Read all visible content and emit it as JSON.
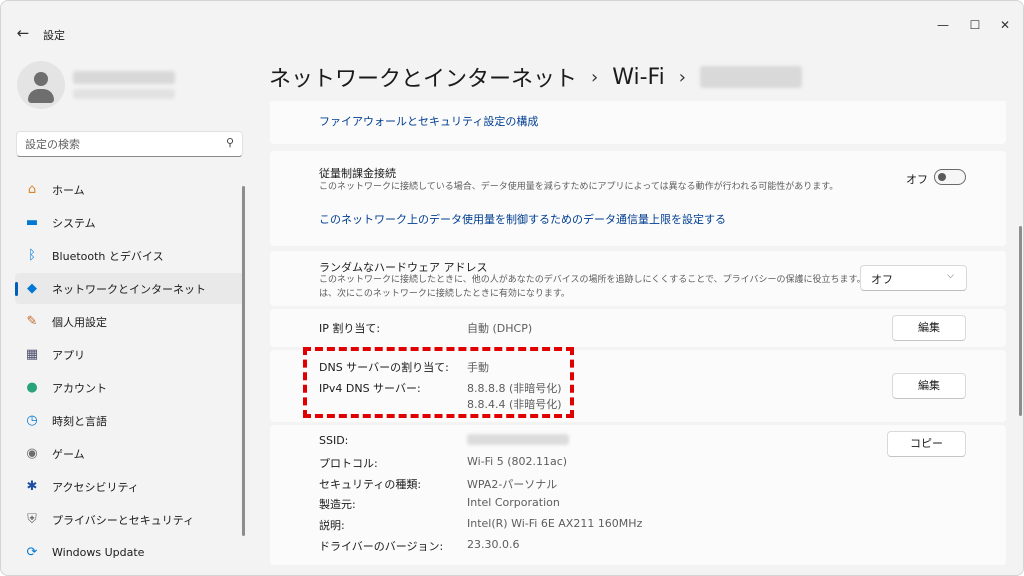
{
  "window": {
    "title": "設定",
    "back_icon": "←",
    "minimize_icon": "—",
    "maximize_icon": "☐",
    "close_icon": "✕"
  },
  "search": {
    "placeholder": "設定の検索",
    "icon": "⚲"
  },
  "sidebar": {
    "items": [
      {
        "label": "ホーム",
        "icon": "home-icon",
        "glyph": "⌂",
        "color": "#d9822b"
      },
      {
        "label": "システム",
        "icon": "system-icon",
        "glyph": "▬",
        "color": "#0078d4"
      },
      {
        "label": "Bluetooth とデバイス",
        "icon": "bluetooth-icon",
        "glyph": "ᛒ",
        "color": "#0078d4"
      },
      {
        "label": "ネットワークとインターネット",
        "icon": "wifi-icon",
        "glyph": "◆",
        "color": "#0078d4",
        "active": true
      },
      {
        "label": "個人用設定",
        "icon": "brush-icon",
        "glyph": "✎",
        "color": "#c0692a"
      },
      {
        "label": "アプリ",
        "icon": "apps-icon",
        "glyph": "▦",
        "color": "#4a4a6a"
      },
      {
        "label": "アカウント",
        "icon": "account-icon",
        "glyph": "●",
        "color": "#2aa37a"
      },
      {
        "label": "時刻と言語",
        "icon": "clock-globe-icon",
        "glyph": "◷",
        "color": "#0078d4"
      },
      {
        "label": "ゲーム",
        "icon": "gamepad-icon",
        "glyph": "◉",
        "color": "#6e6e6e"
      },
      {
        "label": "アクセシビリティ",
        "icon": "accessibility-icon",
        "glyph": "✱",
        "color": "#1a4fa0"
      },
      {
        "label": "プライバシーとセキュリティ",
        "icon": "shield-icon",
        "glyph": "⛨",
        "color": "#6e6e6e"
      },
      {
        "label": "Windows Update",
        "icon": "update-icon",
        "glyph": "⟳",
        "color": "#0078d4"
      }
    ]
  },
  "breadcrumb": {
    "section": "ネットワークとインターネット",
    "sep1": "›",
    "page": "Wi-Fi",
    "sep2": "›"
  },
  "content": {
    "firewall_link": "ファイアウォールとセキュリティ設定の構成",
    "metered": {
      "title": "従量制課金接続",
      "desc": "このネットワークに接続している場合、データ使用量を減らすためにアプリによっては異なる動作が行われる可能性があります。",
      "state": "オフ",
      "limit_link": "このネットワーク上のデータ使用量を制御するためのデータ通信量上限を設定する"
    },
    "random_hw": {
      "title": "ランダムなハードウェア アドレス",
      "desc1": "このネットワークに接続したときに、他の人があなたのデバイスの場所を追跡しにくくすることで、プライバシーの保護に役立ちます。この設定",
      "desc2": "は、次にこのネットワークに接続したときに有効になります。",
      "value": "オフ"
    },
    "ip": {
      "label": "IP 割り当て:",
      "value": "自動 (DHCP)",
      "edit": "編集"
    },
    "dns": {
      "label": "DNS サーバーの割り当て:",
      "value": "手動",
      "ipv4_label": "IPv4 DNS サーバー:",
      "ipv4_value1": "8.8.8.8 (非暗号化)",
      "ipv4_value2": "8.8.4.4 (非暗号化)",
      "edit": "編集"
    },
    "props": {
      "copy": "コピー",
      "rows": [
        {
          "label": "SSID:",
          "value": ""
        },
        {
          "label": "プロトコル:",
          "value": "Wi-Fi 5 (802.11ac)"
        },
        {
          "label": "セキュリティの種類:",
          "value": "WPA2-パーソナル"
        },
        {
          "label": "製造元:",
          "value": "Intel Corporation"
        },
        {
          "label": "説明:",
          "value": "Intel(R) Wi-Fi 6E AX211 160MHz"
        },
        {
          "label": "ドライバーのバージョン:",
          "value": "23.30.0.6"
        }
      ]
    }
  },
  "colors": {
    "accent": "#005fb8",
    "highlight": "#e00000"
  }
}
